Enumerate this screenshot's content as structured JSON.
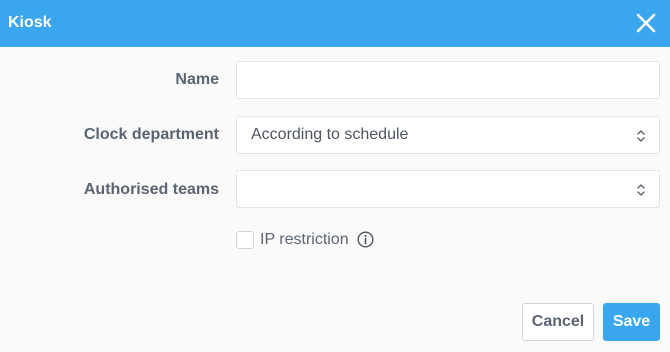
{
  "dialog": {
    "title": "Kiosk",
    "close_icon": "close-icon"
  },
  "form": {
    "name": {
      "label": "Name",
      "value": "",
      "placeholder": ""
    },
    "clock_department": {
      "label": "Clock department",
      "selected": "According to schedule"
    },
    "authorised_teams": {
      "label": "Authorised teams",
      "selected": ""
    },
    "ip_restriction": {
      "label": "IP restriction",
      "checked": false,
      "info_icon": "info-icon"
    }
  },
  "actions": {
    "cancel_label": "Cancel",
    "save_label": "Save"
  },
  "colors": {
    "accent": "#3aa6ee",
    "header_text": "#ffffff",
    "label_text": "#5a6472",
    "border": "#dfe3e8"
  }
}
